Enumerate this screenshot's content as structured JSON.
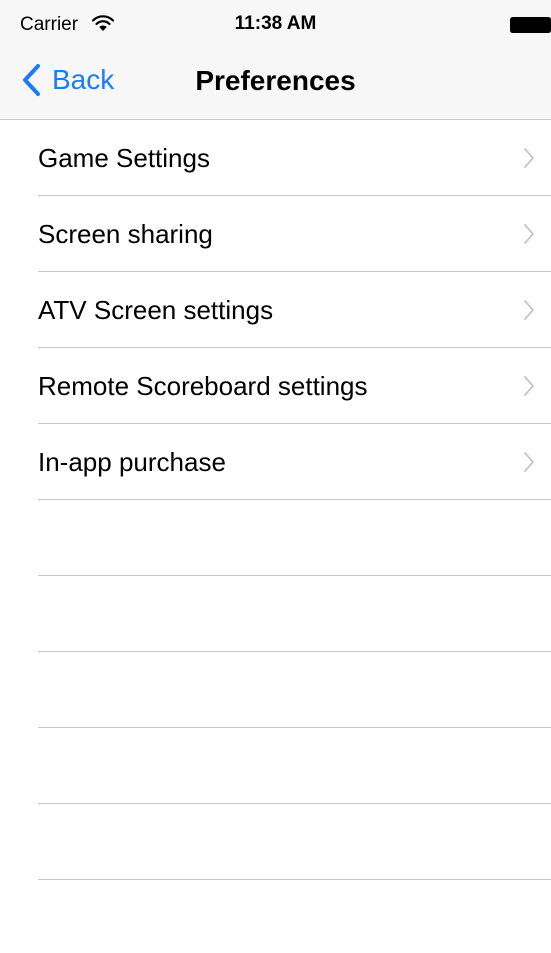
{
  "status_bar": {
    "carrier": "Carrier",
    "time": "11:38 AM",
    "icons": [
      "wifi-icon",
      "battery-icon"
    ]
  },
  "nav_bar": {
    "back_label": "Back",
    "title": "Preferences",
    "accent_color": "#1a7cf6"
  },
  "table": {
    "items": [
      {
        "label": "Game Settings",
        "icon": "chevron-right-icon"
      },
      {
        "label": "Screen sharing",
        "icon": "chevron-right-icon"
      },
      {
        "label": "ATV Screen settings",
        "icon": "chevron-right-icon"
      },
      {
        "label": "Remote Scoreboard settings",
        "icon": "chevron-right-icon"
      },
      {
        "label": "In-app purchase",
        "icon": "chevron-right-icon"
      }
    ],
    "separator_color": "#c8c7cc"
  }
}
